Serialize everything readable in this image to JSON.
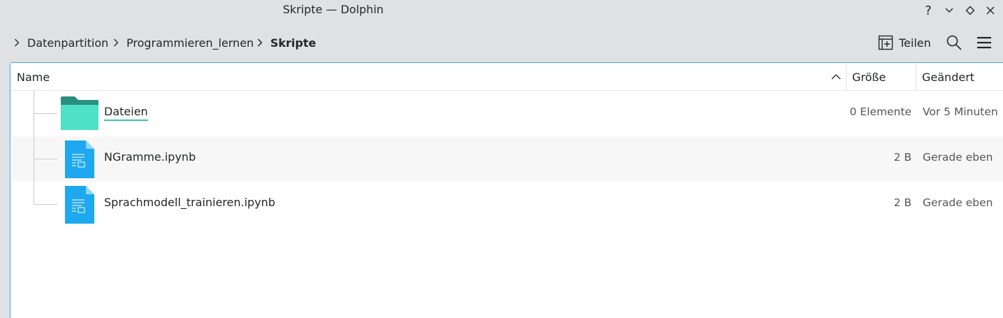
{
  "window": {
    "title": "Skripte — Dolphin",
    "controls": [
      "?",
      "minimize",
      "maximize",
      "close"
    ]
  },
  "breadcrumb": [
    {
      "label": "Datenpartition"
    },
    {
      "label": "Programmieren_lernen"
    },
    {
      "label": "Skripte",
      "current": true
    }
  ],
  "toolbar": {
    "share_label": "Teilen"
  },
  "columns": {
    "name": "Name",
    "size": "Größe",
    "modified": "Geändert",
    "sort_indicator": "ascending"
  },
  "files": [
    {
      "name": "Dateien",
      "size": "0 Elemente",
      "modified": "Vor 5 Minuten",
      "type": "folder",
      "icon": "folder-icon"
    },
    {
      "name": "NGramme.ipynb",
      "size": "2 B",
      "modified": "Gerade eben",
      "type": "file",
      "icon": "document-icon"
    },
    {
      "name": "Sprachmodell_trainieren.ipynb",
      "size": "2 B",
      "modified": "Gerade eben",
      "type": "file",
      "icon": "document-icon"
    }
  ],
  "colors": {
    "accent": "#3daee9",
    "folder": "#4fe0c8",
    "folder_tab": "#2a8f7f",
    "document": "#1ea8f0",
    "window_bg": "#dfe1e3"
  }
}
